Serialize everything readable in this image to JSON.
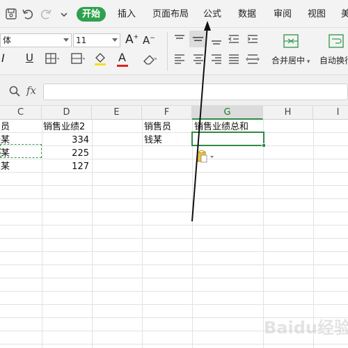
{
  "menu": {
    "tabs": [
      {
        "label": "开始",
        "active": true
      },
      {
        "label": "插入"
      },
      {
        "label": "页面布局"
      },
      {
        "label": "公式"
      },
      {
        "label": "数据"
      },
      {
        "label": "审阅"
      },
      {
        "label": "视图"
      },
      {
        "label": "美"
      }
    ]
  },
  "ribbon": {
    "font_name": "体",
    "font_size": "11",
    "merge_center_label": "合并居中",
    "auto_wrap_label": "自动换行",
    "italic_label": "I",
    "underline_label": "U",
    "bold_a_up": "A",
    "bold_a_down": "A",
    "font_color_a": "A",
    "accent_color": "#2fa14e"
  },
  "formula_bar": {
    "fx_label": "fx",
    "value": ""
  },
  "sheet": {
    "columns": [
      "C",
      "D",
      "E",
      "F",
      "G",
      "H",
      "I"
    ],
    "active_column": "G",
    "rows": [
      {
        "C": "售员",
        "D": "销售业绩2",
        "F": "销售员",
        "G": "销售业绩总和"
      },
      {
        "C": "张某",
        "D": "334",
        "F": "钱某"
      },
      {
        "C": "瓷某",
        "D": "225"
      },
      {
        "C": "王某",
        "D": "127"
      }
    ]
  },
  "watermark": {
    "text": "Baidu经验"
  }
}
